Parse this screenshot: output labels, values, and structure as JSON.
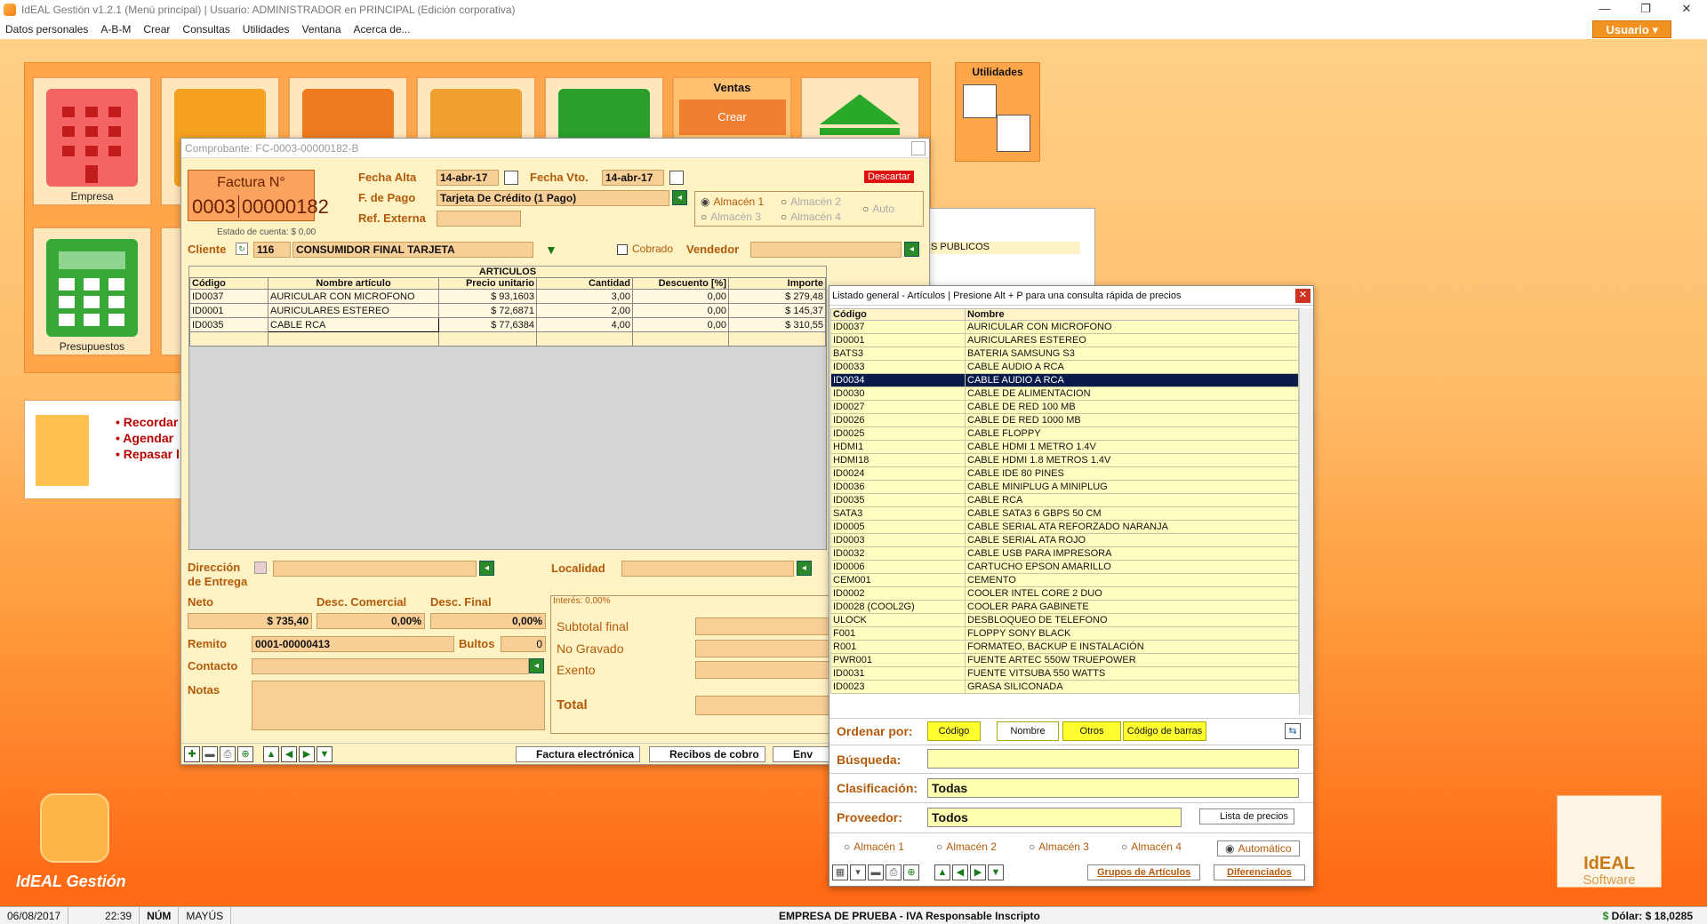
{
  "titlebar": {
    "title": "IdEAL Gestión v1.2.1 (Menú principal) | Usuario: ADMINISTRADOR en PRINCIPAL (Edición corporativa)"
  },
  "menu": [
    "Datos personales",
    "A-B-M",
    "Crear",
    "Consultas",
    "Utilidades",
    "Ventana",
    "Acerca de..."
  ],
  "usuario_btn": "Usuario ▾",
  "tiles": {
    "empresa": "Empresa",
    "presupuestos": "Presupuestos",
    "ventas": "Ventas",
    "crear": "Crear"
  },
  "utilidades": {
    "title": "Utilidades"
  },
  "recordar": [
    "Recordar",
    "Agendar",
    "Repasar l"
  ],
  "app_label": "IdEAL Gestión",
  "ideal_software": {
    "line1": "IdEAL",
    "line2": "Software"
  },
  "statusbar": {
    "date": "06/08/2017",
    "time": "22:39",
    "num": "NÚM",
    "mayus": "MAYÚS",
    "empresa": "EMPRESA DE PRUEBA - IVA Responsable Inscripto",
    "dolar": "Dólar: $ 18,0285"
  },
  "invoice": {
    "title": "Comprobante: FC-0003-00000182-B",
    "factura_label": "Factura N°",
    "factura_pv": "0003",
    "factura_num": "00000182",
    "estado_cuenta": "Estado de cuenta: $ 0,00",
    "fecha_alta_lbl": "Fecha Alta",
    "fecha_alta": "14-abr-17",
    "fecha_vto_lbl": "Fecha Vto.",
    "fecha_vto": "14-abr-17",
    "descartar": "Descartar",
    "fpago_lbl": "F. de Pago",
    "fpago": "Tarjeta De Crédito (1 Pago)",
    "ref_lbl": "Ref. Externa",
    "almacenes": [
      "Almacén 1",
      "Almacén 2",
      "Almacén 3",
      "Almacén 4",
      "Auto"
    ],
    "cliente_lbl": "Cliente",
    "cliente_cod": "116",
    "cliente_nombre": "CONSUMIDOR FINAL TARJETA",
    "cobrado": "Cobrado",
    "vendedor_lbl": "Vendedor",
    "articulos_title": "ARTICULOS",
    "cols": [
      "Código",
      "Nombre artículo",
      "Precio unitario",
      "Cantidad",
      "Descuento [%]",
      "Importe"
    ],
    "rows": [
      [
        "ID0037",
        "AURICULAR CON MICROFONO",
        "$ 93,1603",
        "3,00",
        "0,00",
        "$ 279,48"
      ],
      [
        "ID0001",
        "AURICULARES ESTEREO",
        "$ 72,6871",
        "2,00",
        "0,00",
        "$ 145,37"
      ],
      [
        "ID0035",
        "CABLE RCA",
        "$ 77,6384",
        "4,00",
        "0,00",
        "$ 310,55"
      ]
    ],
    "dir_lbl1": "Dirección",
    "dir_lbl2": "de Entrega",
    "localidad_lbl": "Localidad",
    "neto_lbl": "Neto",
    "neto": "$ 735,40",
    "desc_com_lbl": "Desc. Comercial",
    "desc_com": "0,00%",
    "desc_fin_lbl": "Desc. Final",
    "desc_fin": "0,00%",
    "interes": "Interés: 0,00%",
    "subtotal_lbl": "Subtotal final",
    "no_gravado_lbl": "No Gravado",
    "exento_lbl": "Exento",
    "total_lbl": "Total",
    "remito_lbl": "Remito",
    "remito": "0001-00000413",
    "bultos_lbl": "Bultos",
    "bultos": "0",
    "contacto_lbl": "Contacto",
    "notas_lbl": "Notas",
    "btn_factura_elec": "Factura electrónica",
    "btn_recibos": "Recibos de cobro",
    "btn_env": "Env",
    "bg_field": "S PUBLICOS"
  },
  "listado": {
    "title": "Listado general - Artículos | Presione Alt + P para una consulta rápida de precios",
    "cols": [
      "Código",
      "Nombre"
    ],
    "rows": [
      [
        "ID0037",
        "AURICULAR CON MICROFONO"
      ],
      [
        "ID0001",
        "AURICULARES ESTEREO"
      ],
      [
        "BATS3",
        "BATERIA SAMSUNG S3"
      ],
      [
        "ID0033",
        "CABLE AUDIO A RCA"
      ],
      [
        "ID0034",
        "CABLE AUDIO A RCA"
      ],
      [
        "ID0030",
        "CABLE DE ALIMENTACION"
      ],
      [
        "ID0027",
        "CABLE DE RED 100 MB"
      ],
      [
        "ID0026",
        "CABLE DE RED 1000 MB"
      ],
      [
        "ID0025",
        "CABLE FLOPPY"
      ],
      [
        "HDMI1",
        "CABLE HDMI 1 METRO 1.4V"
      ],
      [
        "HDMI18",
        "CABLE HDMI 1.8 METROS 1.4V"
      ],
      [
        "ID0024",
        "CABLE IDE 80 PINES"
      ],
      [
        "ID0036",
        "CABLE MINIPLUG A MINIPLUG"
      ],
      [
        "ID0035",
        "CABLE RCA"
      ],
      [
        "SATA3",
        "CABLE SATA3 6 GBPS 50 CM"
      ],
      [
        "ID0005",
        "CABLE SERIAL ATA REFORZADO NARANJA"
      ],
      [
        "ID0003",
        "CABLE SERIAL ATA ROJO"
      ],
      [
        "ID0032",
        "CABLE USB PARA IMPRESORA"
      ],
      [
        "ID0006",
        "CARTUCHO EPSON AMARILLO"
      ],
      [
        "CEM001",
        "CEMENTO"
      ],
      [
        "ID0002",
        "COOLER INTEL CORE 2 DUO"
      ],
      [
        "ID0028 (COOL2G)",
        "COOLER PARA GABINETE"
      ],
      [
        "ULOCK",
        "DESBLOQUEO DE TELEFONO"
      ],
      [
        "F001",
        "FLOPPY SONY BLACK"
      ],
      [
        "R001",
        "FORMATEO, BACKUP E INSTALACIÓN"
      ],
      [
        "PWR001",
        "FUENTE ARTEC 550W TRUEPOWER"
      ],
      [
        "ID0031",
        "FUENTE VITSUBA 550 WATTS"
      ],
      [
        "ID0023",
        "GRASA SILICONADA"
      ]
    ],
    "selected_index": 4,
    "ordenar_lbl": "Ordenar por:",
    "ordenar_opts": [
      "Código",
      "Nombre",
      "Otros",
      "Código de barras"
    ],
    "ordenar_active": 1,
    "busqueda_lbl": "Búsqueda:",
    "clasif_lbl": "Clasificación:",
    "clasif_val": "Todas",
    "prov_lbl": "Proveedor:",
    "prov_val": "Todos",
    "lista_precios": "Lista de precios",
    "almacenes": [
      "Almacén 1",
      "Almacén 2",
      "Almacén 3",
      "Almacén 4",
      "Automático"
    ],
    "grupos": "Grupos de Artículos",
    "diferenciados": "Diferenciados"
  }
}
